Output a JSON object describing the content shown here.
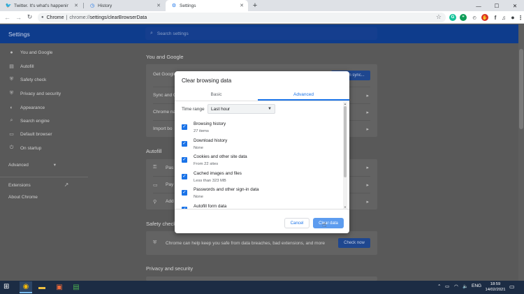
{
  "browser": {
    "tabs": [
      {
        "title": "Twitter. It's what's happening / T",
        "icon": "twitter-icon",
        "active": false
      },
      {
        "title": "History",
        "icon": "history-icon",
        "active": false
      },
      {
        "title": "Settings",
        "icon": "gear-icon",
        "active": true
      }
    ],
    "new_tab_glyph": "+",
    "window_controls": {
      "minimize": "—",
      "maximize": "☐",
      "close": "✕"
    },
    "url_host": "Chrome",
    "url_scheme": "chrome://",
    "url_path": "settings/clearBrowserData",
    "extensions": [
      {
        "name": "grammarly-icon",
        "color": "#15c39a",
        "glyph": "G"
      },
      {
        "name": "hangouts-icon",
        "color": "#0f9d58",
        "glyph": "❞"
      },
      {
        "name": "adblock-icon",
        "color": "#d93025",
        "glyph": "✋"
      },
      {
        "name": "font-icon",
        "color": "#3c4043",
        "glyph": "f"
      },
      {
        "name": "notes-icon",
        "color": "#3c4043",
        "glyph": "♫"
      }
    ]
  },
  "settings": {
    "title": "Settings",
    "search_placeholder": "Search settings",
    "sidebar": [
      {
        "label": "You and Google",
        "icon": "person-icon",
        "glyph": "👤"
      },
      {
        "label": "Autofill",
        "icon": "autofill-icon",
        "glyph": "▤"
      },
      {
        "label": "Safety check",
        "icon": "shield-icon",
        "glyph": "⛨"
      },
      {
        "label": "Privacy and security",
        "icon": "lock-icon",
        "glyph": "⛨"
      },
      {
        "label": "Appearance",
        "icon": "palette-icon",
        "glyph": "◐"
      },
      {
        "label": "Search engine",
        "icon": "search-icon",
        "glyph": "⌕"
      },
      {
        "label": "Default browser",
        "icon": "browser-icon",
        "glyph": "▭"
      },
      {
        "label": "On startup",
        "icon": "power-icon",
        "glyph": "⏻"
      }
    ],
    "advanced": "Advanced",
    "advanced_caret": "▾",
    "extensions": "Extensions",
    "about": "About Chrome",
    "you_and_google": {
      "heading": "You and Google",
      "rows": [
        "Get Google",
        "Sync and Go",
        "Chrome na",
        "Import bo"
      ],
      "sync_button": "Turn on sync..."
    },
    "autofill": {
      "heading": "Autofill",
      "rows": [
        "Pas",
        "Pay",
        "Add"
      ]
    },
    "safety_check": {
      "heading": "Safety check",
      "text": "Chrome can help keep you safe from data breaches, bad extensions, and more",
      "button": "Check now"
    },
    "privacy": {
      "heading": "Privacy and security"
    }
  },
  "dialog": {
    "title": "Clear browsing data",
    "tabs": [
      "Basic",
      "Advanced"
    ],
    "selected_tab": "Advanced",
    "time_range_label": "Time range",
    "time_range_value": "Last hour",
    "options": [
      {
        "label": "Browsing history",
        "sub": "27 items",
        "checked": true
      },
      {
        "label": "Download history",
        "sub": "None",
        "checked": true
      },
      {
        "label": "Cookies and other site data",
        "sub": "From 22 sites",
        "checked": true
      },
      {
        "label": "Cached images and files",
        "sub": "Less than 323 MB",
        "checked": true
      },
      {
        "label": "Passwords and other sign-in data",
        "sub": "None",
        "checked": true
      },
      {
        "label": "Autofill form data",
        "sub": "",
        "checked": true
      }
    ],
    "cancel": "Cancel",
    "clear": "Clear data"
  },
  "taskbar": {
    "apps": [
      {
        "name": "chrome-app",
        "glyph": "◉",
        "color": "#fbbc05",
        "active": true
      },
      {
        "name": "file-explorer-app",
        "glyph": "▬",
        "color": "#f0c040",
        "active": false
      },
      {
        "name": "snip-app",
        "glyph": "▣",
        "color": "#f26b3a",
        "active": false
      },
      {
        "name": "notepad-app",
        "glyph": "▤",
        "color": "#4caf50",
        "active": false
      }
    ],
    "language": "ENG",
    "time": "18:59",
    "date": "14/02/2021"
  },
  "colors": {
    "accent": "#1a73e8",
    "header_dim": "#0e3c8c",
    "overlay_bg": "#595959"
  }
}
